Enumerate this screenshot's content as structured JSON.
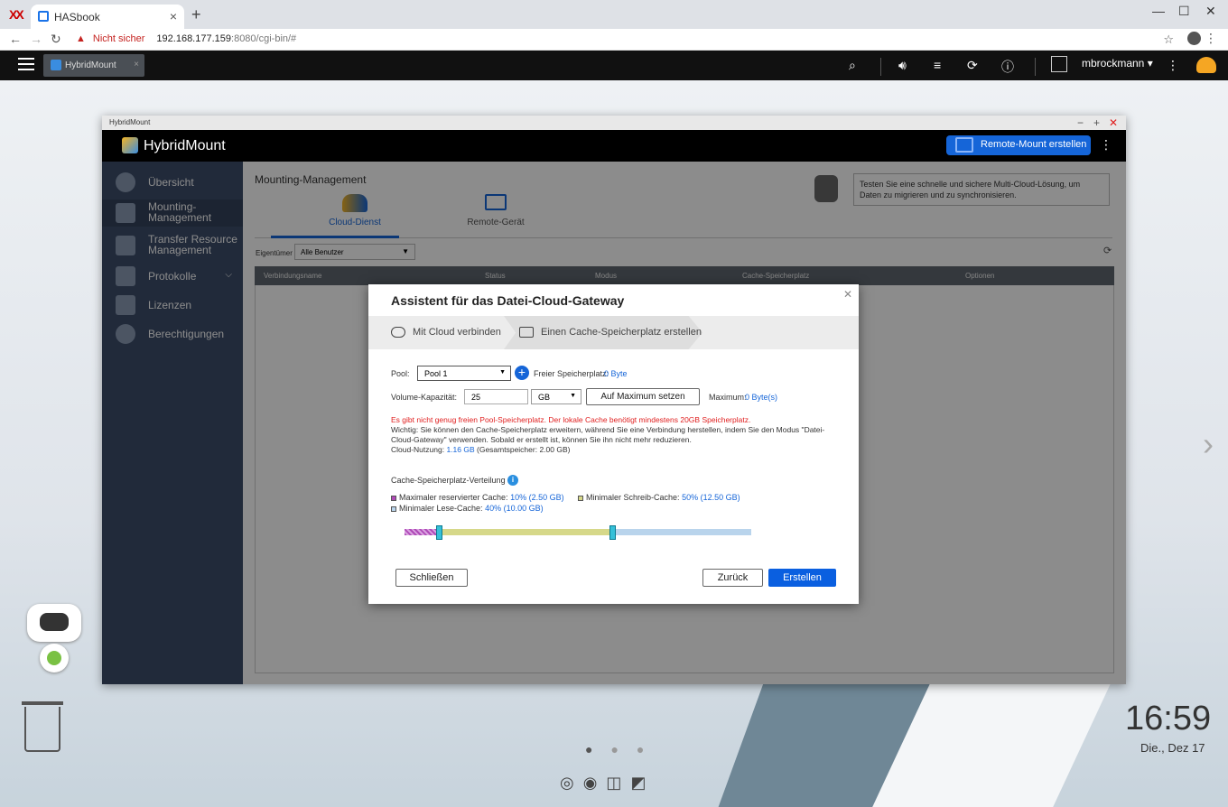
{
  "browser": {
    "tab_title": "HASbook",
    "security_label": "Nicht sicher",
    "url_host": "192.168.177.159",
    "url_rest": ":8080/cgi-bin/#"
  },
  "qts": {
    "app_tab": "HybridMount",
    "username": "mbrockmann ▾"
  },
  "window": {
    "title": "HybridMount",
    "app_name": "HybridMount",
    "remote_mount_button": "Remote-Mount erstellen"
  },
  "sidebar": {
    "items": [
      {
        "label": "Übersicht"
      },
      {
        "label": "Mounting-\nManagement"
      },
      {
        "label": "Transfer Resource\nManagement"
      },
      {
        "label": "Protokolle"
      },
      {
        "label": "Lizenzen"
      },
      {
        "label": "Berechtigungen"
      }
    ]
  },
  "main": {
    "title": "Mounting-Management",
    "tabs": [
      {
        "label": "Cloud-Dienst"
      },
      {
        "label": "Remote-Gerät"
      }
    ],
    "hint": "Testen Sie eine schnelle und sichere Multi-Cloud-Lösung, um Daten zu migrieren und zu synchronisieren.",
    "owner_label": "Eigentümer",
    "owner_value": "Alle Benutzer",
    "columns": [
      "Verbindungsname",
      "Status",
      "Modus",
      "Cache-Speicherplatz",
      "Optionen"
    ]
  },
  "dialog": {
    "title": "Assistent für das Datei-Cloud-Gateway",
    "steps": [
      "Mit Cloud verbinden",
      "Einen Cache-Speicherplatz erstellen"
    ],
    "pool_label": "Pool:",
    "pool_value": "Pool 1",
    "free_label": "Freier Speicherplatz:",
    "free_value": "0 Byte",
    "capacity_label": "Volume-Kapazität:",
    "capacity_value": "25",
    "unit_value": "GB",
    "max_button": "Auf Maximum setzen",
    "max_label": "Maximum:",
    "max_value": "0 Byte(s)",
    "error": "Es gibt nicht genug freien Pool-Speicherplatz. Der lokale Cache benötigt mindestens 20GB Speicherplatz.",
    "note": "Wichtig: Sie können den Cache-Speicherplatz erweitern, während Sie eine Verbindung herstellen, indem Sie den Modus \"Datei-Cloud-Gateway\" verwenden. Sobald er erstellt ist, können Sie ihn nicht mehr reduzieren.",
    "usage_label": "Cloud-Nutzung:",
    "usage_value": "1.16 GB",
    "usage_total": "(Gesamtspeicher: 2.00 GB)",
    "dist_label": "Cache-Speicherplatz-Verteilung",
    "legend": [
      {
        "label": "Maximaler reservierter Cache:",
        "value": "10% (2.50 GB)",
        "percent": 10,
        "color": "#b04ab8"
      },
      {
        "label": "Minimaler Schreib-Cache:",
        "value": "50% (12.50 GB)",
        "percent": 50,
        "color": "#d6d889"
      },
      {
        "label": "Minimaler Lese-Cache:",
        "value": "40% (10.00 GB)",
        "percent": 40,
        "color": "#b9d4ec"
      }
    ],
    "close_button": "Schließen",
    "back_button": "Zurück",
    "create_button": "Erstellen"
  },
  "desktop": {
    "time": "16:59",
    "date": "Die., Dez 17"
  }
}
